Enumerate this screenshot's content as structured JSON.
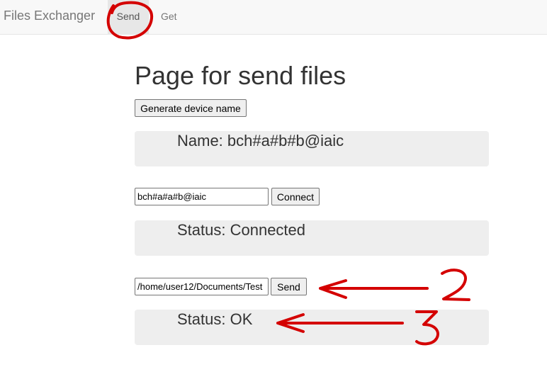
{
  "navbar": {
    "brand": "Files Exchanger",
    "links": [
      {
        "label": "Send"
      },
      {
        "label": "Get"
      }
    ]
  },
  "main": {
    "title": "Page for send files",
    "generate_button": "Generate device name",
    "name_panel": "Name: bch#a#b#b@iaic",
    "device_input_value": "bch#a#a#b@iaic",
    "connect_button": "Connect",
    "connection_status": "Status: Connected",
    "file_path_value": "/home/user12/Documents/Test",
    "send_button": "Send",
    "send_status": "Status: OK"
  },
  "annotations": {
    "marker_2": "2",
    "marker_3": "3",
    "ink_color": "#d40000"
  }
}
